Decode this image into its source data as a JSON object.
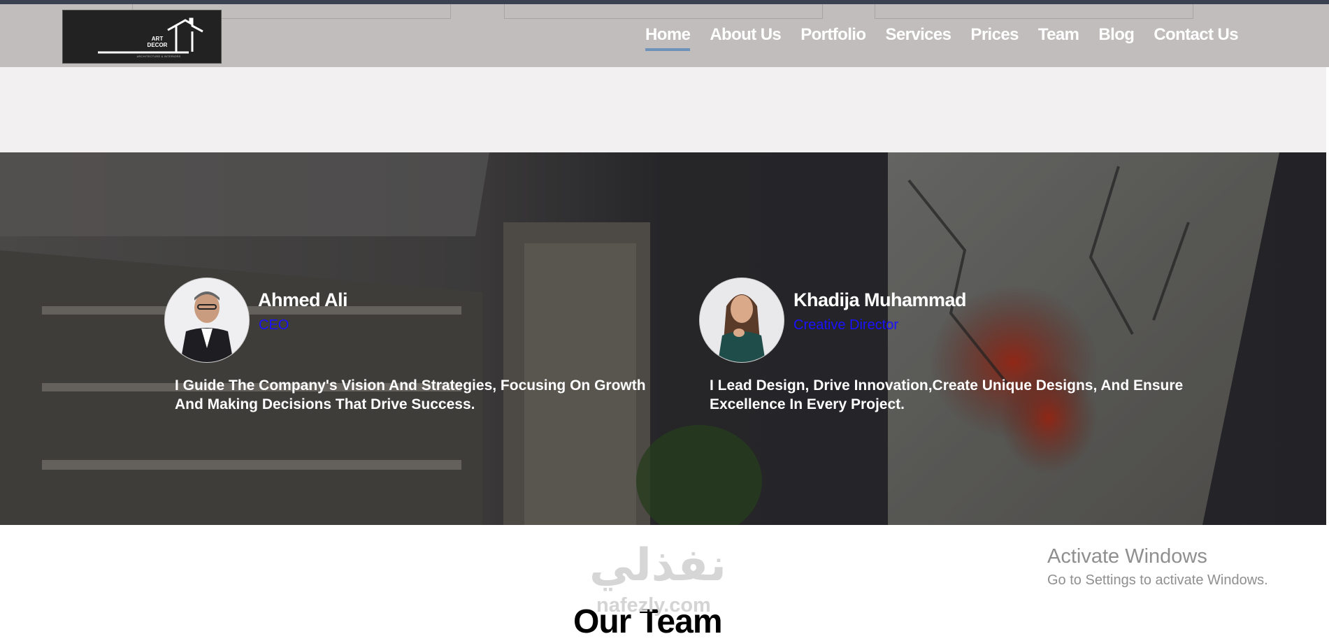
{
  "logo": {
    "line1": "ART",
    "line2": "DECOR",
    "tagline": "ARCHITECTURE & INTERIORS"
  },
  "nav": {
    "items": [
      {
        "label": "Home",
        "active": true
      },
      {
        "label": "About Us"
      },
      {
        "label": "Portfolio"
      },
      {
        "label": "Services"
      },
      {
        "label": "Prices"
      },
      {
        "label": "Team"
      },
      {
        "label": "Blog"
      },
      {
        "label": "Contact Us"
      }
    ],
    "active_underline_color": "#6f92bb"
  },
  "team": {
    "members": [
      {
        "name": "Ahmed Ali",
        "role": "CEO",
        "description": "I Guide The Company's Vision And Strategies, Focusing On Growth And Making Decisions That Drive Success."
      },
      {
        "name": "Khadija Muhammad",
        "role": "Creative Director",
        "description": "I Lead Design, Drive Innovation,Create Unique Designs, And Ensure Excellence In Every Project."
      }
    ],
    "role_color": "#1a12ff",
    "section_title": "Our Team"
  },
  "watermark": {
    "arabic": "نفذلي",
    "latin": "nafezly.com"
  },
  "os_notice": {
    "title": "Activate Windows",
    "subtitle": "Go to Settings to activate Windows."
  }
}
